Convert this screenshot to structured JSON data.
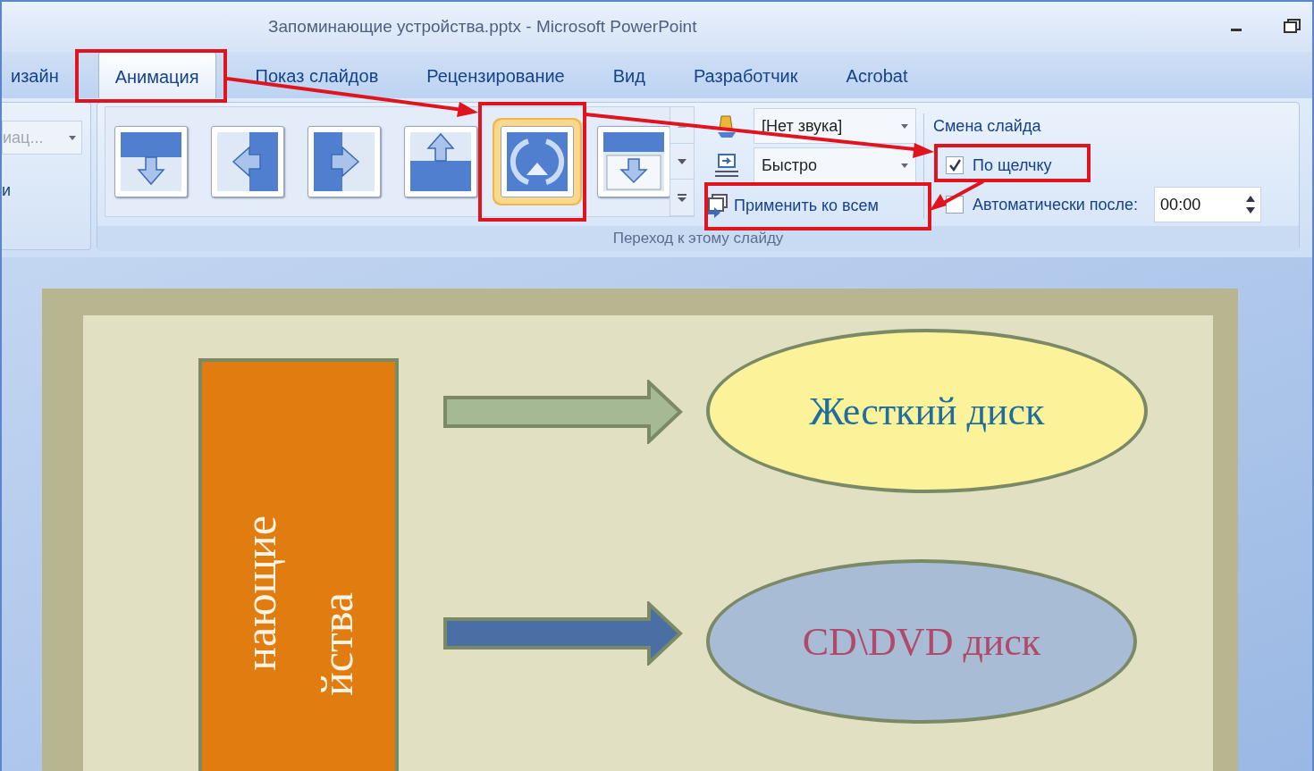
{
  "window": {
    "title": "Запоминающие устройства.pptx - Microsoft PowerPoint"
  },
  "tabs": [
    {
      "label": "изайн",
      "selected": false
    },
    {
      "label": "Анимация",
      "selected": true
    },
    {
      "label": "Показ слайдов",
      "selected": false
    },
    {
      "label": "Рецензирование",
      "selected": false
    },
    {
      "label": "Вид",
      "selected": false
    },
    {
      "label": "Разработчик",
      "selected": false
    },
    {
      "label": "Acrobat",
      "selected": false
    }
  ],
  "ribbon": {
    "left_group": {
      "dropdown": "иац...",
      "disabled": true,
      "label": "и"
    },
    "transitions": {
      "label": "Переход к этому слайду",
      "gallery": [
        {
          "kind": "down",
          "selected": false
        },
        {
          "kind": "left",
          "selected": false
        },
        {
          "kind": "right",
          "selected": false
        },
        {
          "kind": "up",
          "selected": false
        },
        {
          "kind": "wheel",
          "selected": true
        },
        {
          "kind": "cover",
          "selected": false
        }
      ],
      "sound": "[Нет звука]",
      "speed": "Быстро",
      "apply_all": "Применить ко всем"
    },
    "advance": {
      "title": "Смена слайда",
      "on_click": {
        "label": "По щелчку",
        "checked": true
      },
      "after_time": {
        "label": "Автоматически после:",
        "checked": false,
        "value": "00:00"
      }
    }
  },
  "slide": {
    "title_lines": [
      "нающие",
      "йства"
    ],
    "items": [
      {
        "label": "Жесткий диск",
        "color": "#fbf29a",
        "kind": "sage"
      },
      {
        "label": "CD\\DVD диск",
        "color": "#a9bcd6",
        "kind": "steel"
      }
    ]
  }
}
